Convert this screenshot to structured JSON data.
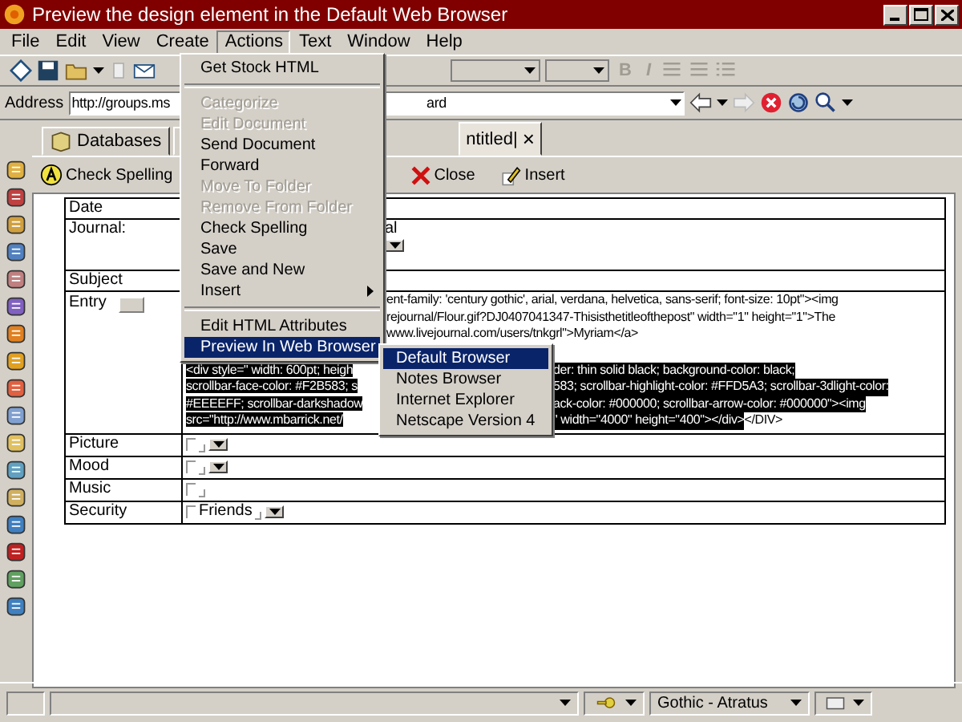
{
  "window": {
    "title": "Preview the design element in the Default Web Browser"
  },
  "menu_bar": [
    {
      "label": "File",
      "selected": false
    },
    {
      "label": "Edit",
      "selected": false
    },
    {
      "label": "View",
      "selected": false
    },
    {
      "label": "Create",
      "selected": false
    },
    {
      "label": "Actions",
      "selected": true
    },
    {
      "label": "Text",
      "selected": false
    },
    {
      "label": "Window",
      "selected": false
    },
    {
      "label": "Help",
      "selected": false
    }
  ],
  "toolbar": {
    "format_buttons": [
      {
        "label": "B",
        "disabled": true
      },
      {
        "label": "I",
        "disabled": true
      }
    ]
  },
  "address_bar": {
    "label": "Address",
    "value": "http://groups.ms",
    "value_tail": "ard"
  },
  "tabs": [
    {
      "label": "Databases",
      "selected": false,
      "closable": false
    },
    {
      "selected": false,
      "closable": false
    },
    {
      "label": "ntitled|",
      "selected": true,
      "closable": true,
      "close_label": "×"
    }
  ],
  "action_bar": [
    {
      "label": "Check Spelling",
      "kind": "spell"
    },
    {
      "label": "Close",
      "kind": "close"
    },
    {
      "label": "Insert",
      "kind": "insert"
    }
  ],
  "document": {
    "fields": [
      {
        "label": "Date",
        "kind": "text"
      },
      {
        "label": "Journal:",
        "kind": "journal",
        "value": "al"
      },
      {
        "label": "Subject",
        "kind": "text"
      },
      {
        "label": "Entry",
        "kind": "entry",
        "lines": [
          {
            "right": [
              {
                "text": "ent-family: 'century gothic', arial, verdana, helvetica, sans-serif; font-size: 10pt\"><img",
                "highlighted": false
              }
            ]
          },
          {
            "right": [
              {
                "text": "rejournal/Flour.gif?DJ0407041347-Thisisthetitleofthepost\" width=\"1\" height=\"1\">The",
                "highlighted": false
              }
            ]
          },
          {
            "right": [
              {
                "text": "www.livejournal.com/users/tnkgrl\">Myriam</a>",
                "highlighted": false
              }
            ]
          },
          {
            "left": {
              "text": "<div style=\" width: 600pt; heigh",
              "highlighted": true
            },
            "right": [
              {
                "text": "der: thin solid black; background-color: black;",
                "highlighted": true
              }
            ]
          },
          {
            "left": {
              "text": "scrollbar-face-color: #F2B583; s",
              "highlighted": true
            },
            "right": [
              {
                "text": "583; scrollbar-highlight-color: #FFD5A3; scrollbar-3dlight-color:",
                "highlighted": true
              }
            ]
          },
          {
            "left": {
              "text": "#EEEEFF; scrollbar-darkshadow",
              "highlighted": true
            },
            "right": [
              {
                "text": "ack-color: #000000; scrollbar-arrow-color: #000000\"><img",
                "highlighted": true
              }
            ]
          },
          {
            "left": {
              "text": "src=\"http://www.mbarrick.net/",
              "highlighted": true
            },
            "right": [
              {
                "text": "\" width=\"4000\" height=\"400\"></div>",
                "highlighted": true
              },
              {
                "text": "</DIV>",
                "highlighted": false
              }
            ]
          }
        ]
      },
      {
        "label": "Picture",
        "kind": "dropdown"
      },
      {
        "label": "Mood",
        "kind": "dropdown"
      },
      {
        "label": "Music",
        "kind": "blank"
      },
      {
        "label": "Security",
        "kind": "dropdown",
        "value": "Friends"
      }
    ]
  },
  "actions_menu": [
    {
      "kind": "item",
      "label": "Get Stock HTML",
      "disabled": false,
      "selected": false
    },
    {
      "kind": "separator"
    },
    {
      "kind": "item",
      "label": "Categorize",
      "disabled": true,
      "selected": false
    },
    {
      "kind": "item",
      "label": "Edit Document",
      "disabled": true,
      "selected": false
    },
    {
      "kind": "item",
      "label": "Send Document",
      "disabled": false,
      "selected": false
    },
    {
      "kind": "item",
      "label": "Forward",
      "disabled": false,
      "selected": false
    },
    {
      "kind": "item",
      "label": "Move To Folder",
      "disabled": true,
      "selected": false
    },
    {
      "kind": "item",
      "label": "Remove From Folder",
      "disabled": true,
      "selected": false
    },
    {
      "kind": "item",
      "label": "Check Spelling",
      "disabled": false,
      "selected": false
    },
    {
      "kind": "item",
      "label": "Save",
      "disabled": false,
      "selected": false
    },
    {
      "kind": "item",
      "label": "Save and New",
      "disabled": false,
      "selected": false
    },
    {
      "kind": "submenu",
      "label": "Insert",
      "disabled": false,
      "selected": false
    },
    {
      "kind": "separator"
    },
    {
      "kind": "item",
      "label": "Edit HTML Attributes",
      "disabled": false,
      "selected": false
    },
    {
      "kind": "submenu",
      "label": "Preview In Web Browser",
      "disabled": false,
      "selected": true
    }
  ],
  "browser_submenu": [
    {
      "label": "Default Browser",
      "selected": true
    },
    {
      "label": "Notes Browser",
      "selected": false
    },
    {
      "label": "Internet Explorer",
      "selected": false
    },
    {
      "label": "Netscape Version 4",
      "selected": false
    }
  ],
  "status_bar": {
    "font": "Gothic - Atratus"
  }
}
